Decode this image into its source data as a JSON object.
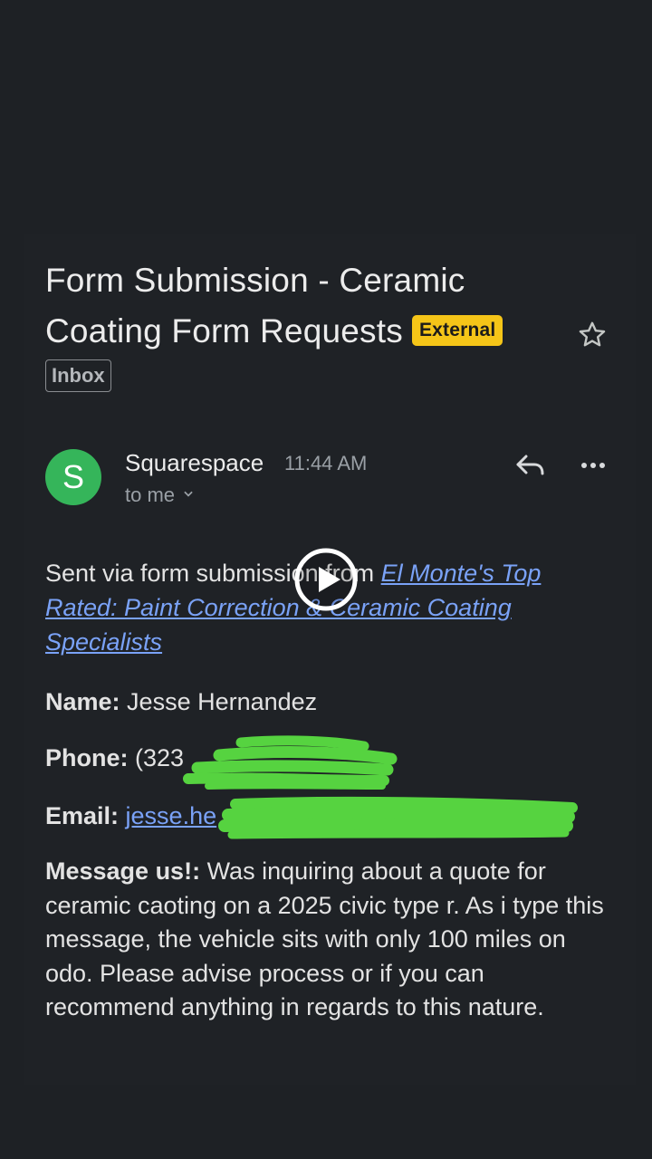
{
  "email": {
    "subject": "Form Submission - Ceramic Coating Form Requests",
    "external_label": "External",
    "folder_label": "Inbox",
    "sender": {
      "avatar_letter": "S",
      "avatar_color": "#35b55a",
      "name": "Squarespace",
      "time": "11:44 AM",
      "recipient": "to me"
    },
    "body": {
      "intro_prefix": "Sent via form submission from ",
      "site_link_text": "El Monte's Top Rated: Paint Correction & Ceramic Coating Specialists",
      "name_label": "Name:",
      "name_value": "Jesse Hernandez",
      "phone_label": "Phone:",
      "phone_visible": "(323",
      "email_label": "Email:",
      "email_visible": "jesse.he",
      "message_label": "Message us!:",
      "message_value": "Was inquiring about a quote for ceramic caoting on a 2025 civic type r. As i type this message, the vehicle sits with only 100 miles on odo. Please advise process or if you can recommend anything in regards to this nature."
    }
  },
  "icons": {
    "star": "star-icon",
    "reply": "reply-icon",
    "more": "more-vert-icon",
    "chevron": "chevron-down-icon",
    "play": "play-icon"
  },
  "colors": {
    "background": "#1e2125",
    "external_badge": "#f5c518",
    "link": "#7aa2f7",
    "avatar": "#35b55a",
    "redaction": "#56d340"
  }
}
